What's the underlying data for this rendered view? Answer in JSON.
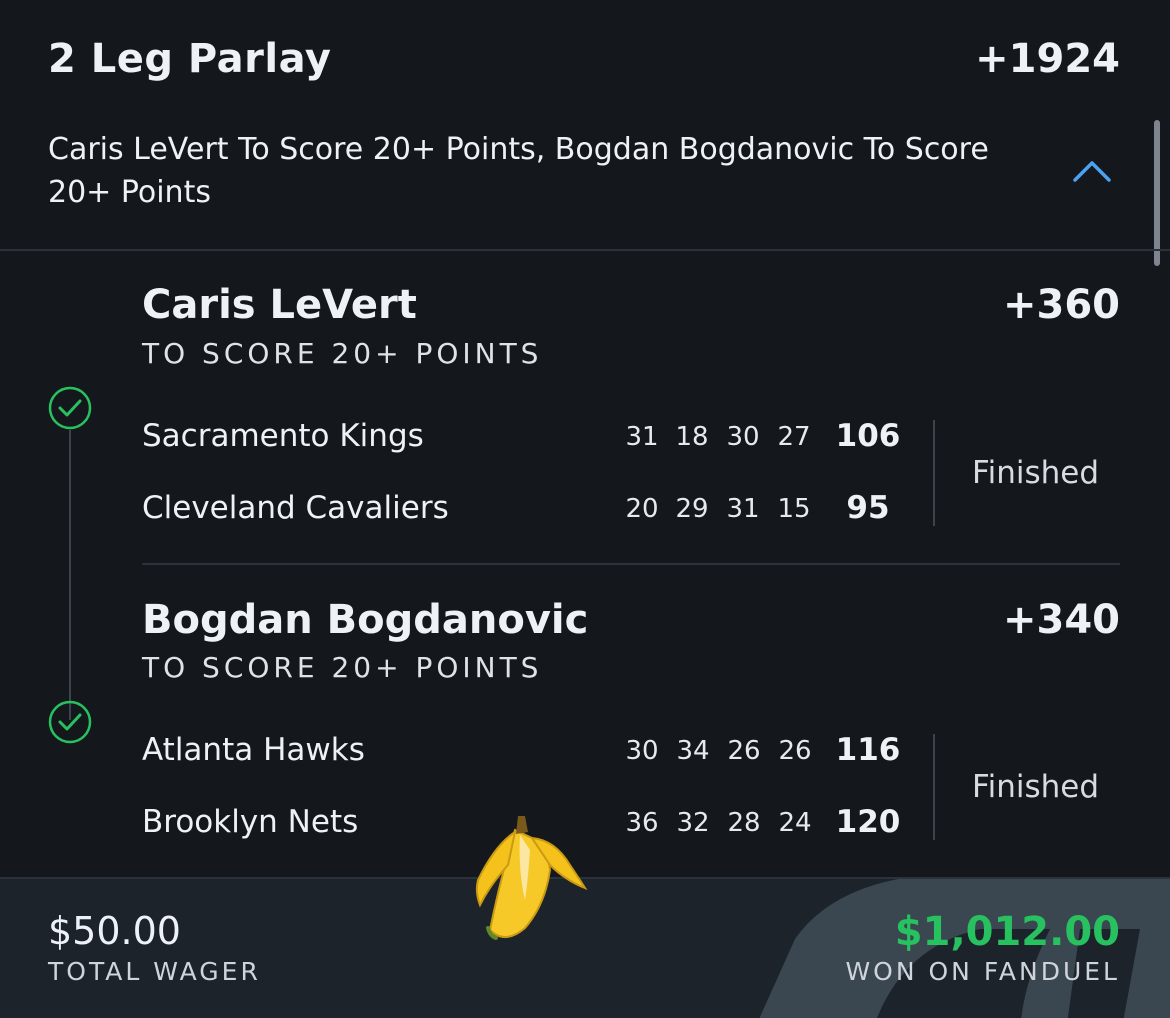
{
  "bet": {
    "title": "2 Leg Parlay",
    "odds": "+1924",
    "description": "Caris LeVert To Score 20+ Points, Bogdan Bogdanovic To Score 20+ Points"
  },
  "legs": [
    {
      "player": "Caris LeVert",
      "odds": "+360",
      "market": "TO SCORE 20+ POINTS",
      "status": "Finished",
      "result": "won",
      "teams": [
        {
          "name": "Sacramento Kings",
          "quarters": [
            "31",
            "18",
            "30",
            "27"
          ],
          "final": "106"
        },
        {
          "name": "Cleveland Cavaliers",
          "quarters": [
            "20",
            "29",
            "31",
            "15"
          ],
          "final": "95"
        }
      ]
    },
    {
      "player": "Bogdan Bogdanovic",
      "odds": "+340",
      "market": "TO SCORE 20+ POINTS",
      "status": "Finished",
      "result": "won",
      "teams": [
        {
          "name": "Atlanta Hawks",
          "quarters": [
            "30",
            "34",
            "26",
            "26"
          ],
          "final": "116"
        },
        {
          "name": "Brooklyn Nets",
          "quarters": [
            "36",
            "32",
            "28",
            "24"
          ],
          "final": "120"
        }
      ]
    }
  ],
  "footer": {
    "wager": "$50.00",
    "wager_label": "TOTAL WAGER",
    "won": "$1,012.00",
    "won_label": "WON ON FANDUEL"
  },
  "icons": {
    "chevron": "chevron-up-icon",
    "check": "check-circle-icon",
    "banana": "banana-emoji"
  },
  "colors": {
    "background": "#14181d",
    "accent": "#4aa3f0",
    "success": "#27c25f"
  }
}
